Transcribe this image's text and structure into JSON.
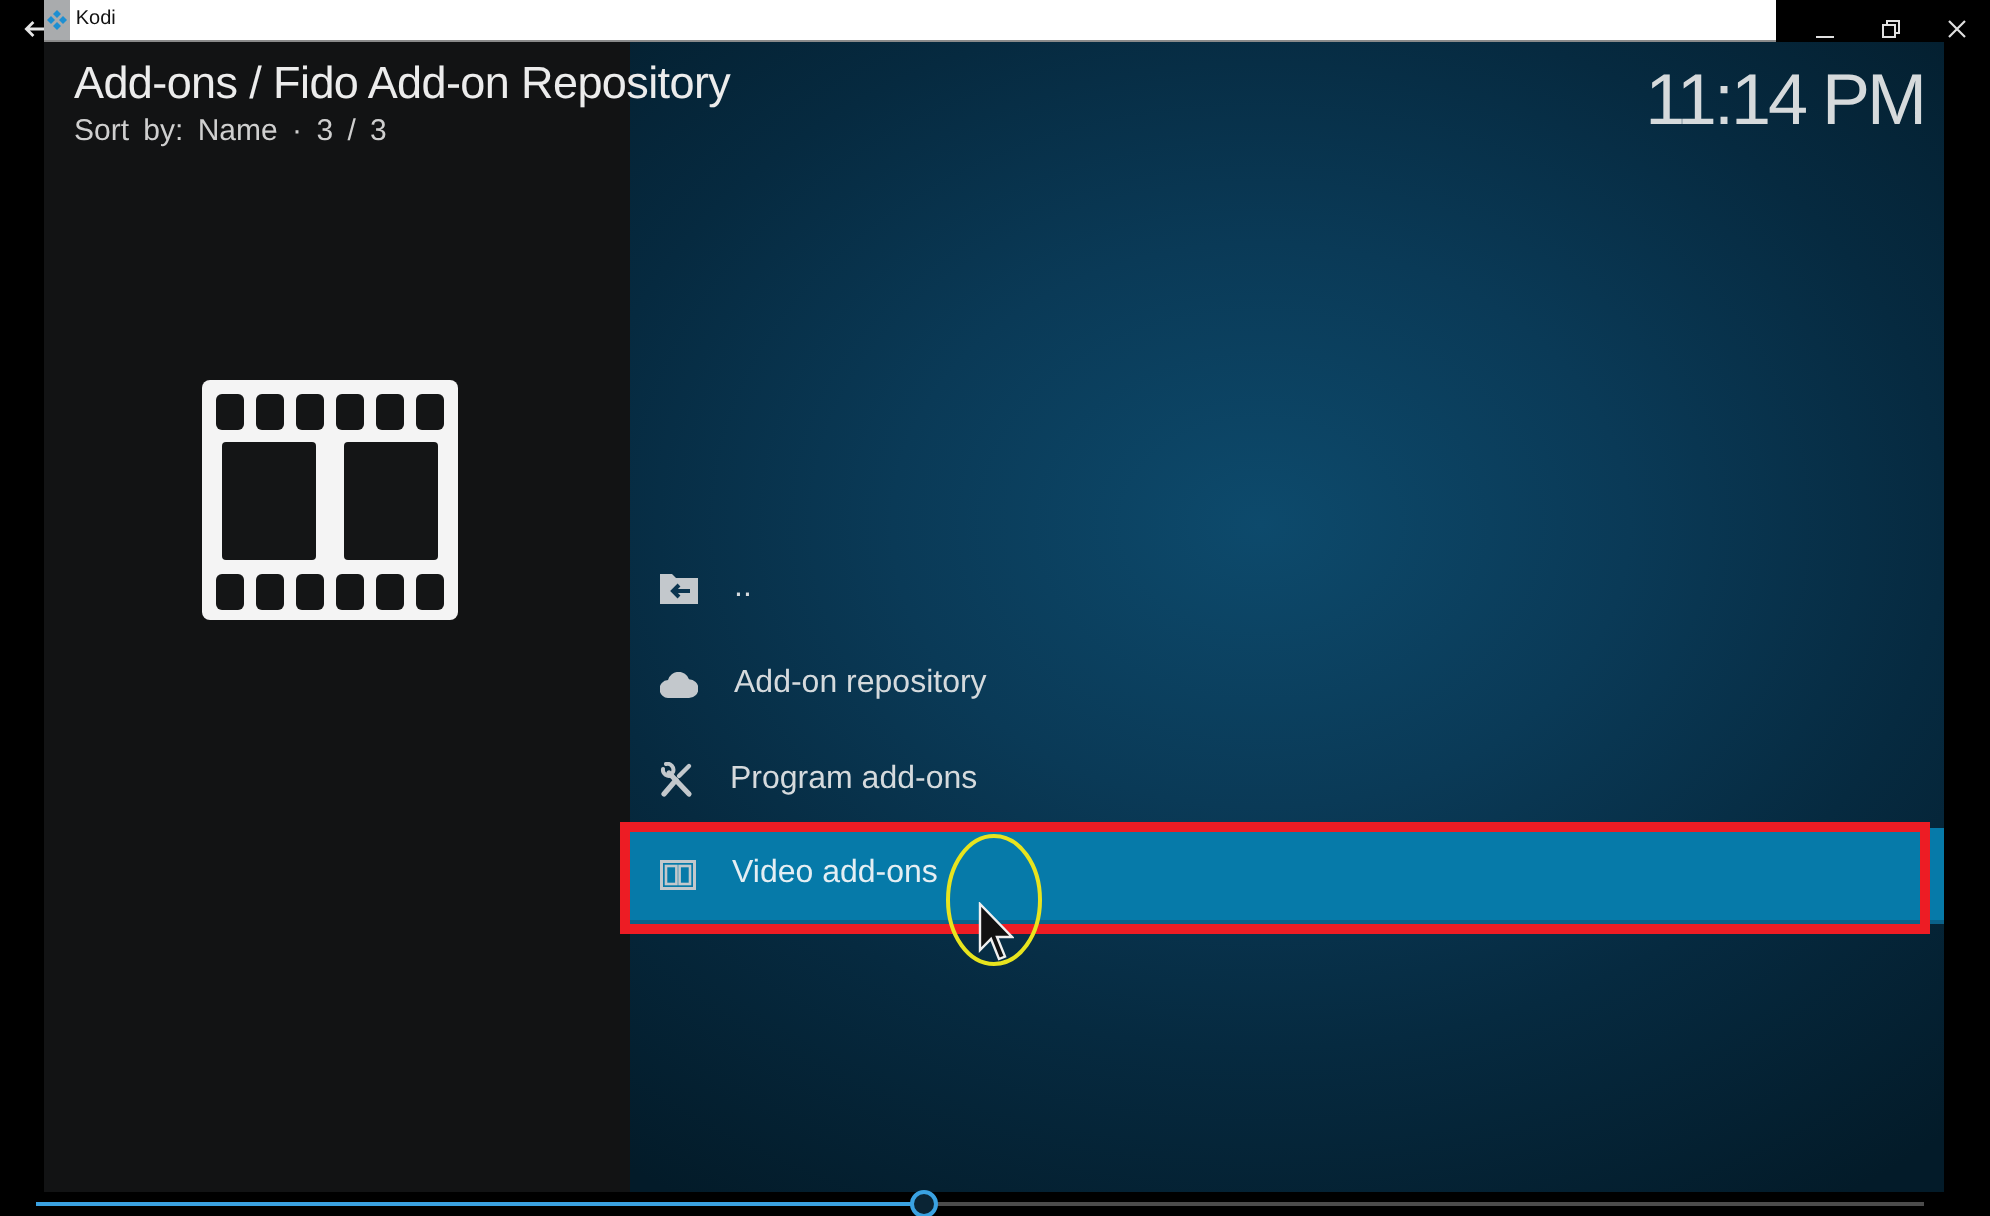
{
  "window": {
    "title": "Kodi"
  },
  "header": {
    "breadcrumb": "Add-ons / Fido Add-on Repository",
    "sort": "Sort by: Name · 3 / 3",
    "clock": "11:14 PM"
  },
  "items": [
    {
      "kind": "parent",
      "label": "..",
      "selected": false
    },
    {
      "kind": "repository",
      "label": "Add-on repository",
      "selected": false
    },
    {
      "kind": "program",
      "label": "Program add-ons",
      "selected": false
    },
    {
      "kind": "video",
      "label": "Video add-ons",
      "selected": true
    }
  ],
  "seek_bar": {
    "level": 0.47
  }
}
